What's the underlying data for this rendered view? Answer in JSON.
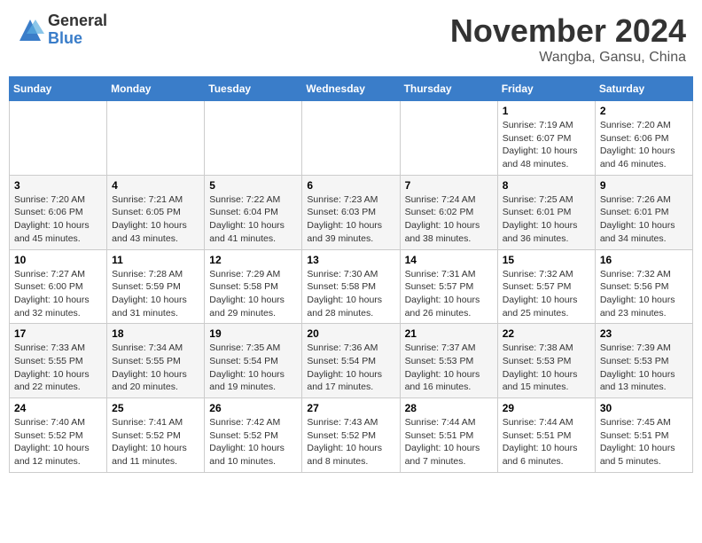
{
  "header": {
    "logo_general": "General",
    "logo_blue": "Blue",
    "month": "November 2024",
    "location": "Wangba, Gansu, China"
  },
  "weekdays": [
    "Sunday",
    "Monday",
    "Tuesday",
    "Wednesday",
    "Thursday",
    "Friday",
    "Saturday"
  ],
  "weeks": [
    [
      {
        "day": "",
        "info": ""
      },
      {
        "day": "",
        "info": ""
      },
      {
        "day": "",
        "info": ""
      },
      {
        "day": "",
        "info": ""
      },
      {
        "day": "",
        "info": ""
      },
      {
        "day": "1",
        "info": "Sunrise: 7:19 AM\nSunset: 6:07 PM\nDaylight: 10 hours\nand 48 minutes."
      },
      {
        "day": "2",
        "info": "Sunrise: 7:20 AM\nSunset: 6:06 PM\nDaylight: 10 hours\nand 46 minutes."
      }
    ],
    [
      {
        "day": "3",
        "info": "Sunrise: 7:20 AM\nSunset: 6:06 PM\nDaylight: 10 hours\nand 45 minutes."
      },
      {
        "day": "4",
        "info": "Sunrise: 7:21 AM\nSunset: 6:05 PM\nDaylight: 10 hours\nand 43 minutes."
      },
      {
        "day": "5",
        "info": "Sunrise: 7:22 AM\nSunset: 6:04 PM\nDaylight: 10 hours\nand 41 minutes."
      },
      {
        "day": "6",
        "info": "Sunrise: 7:23 AM\nSunset: 6:03 PM\nDaylight: 10 hours\nand 39 minutes."
      },
      {
        "day": "7",
        "info": "Sunrise: 7:24 AM\nSunset: 6:02 PM\nDaylight: 10 hours\nand 38 minutes."
      },
      {
        "day": "8",
        "info": "Sunrise: 7:25 AM\nSunset: 6:01 PM\nDaylight: 10 hours\nand 36 minutes."
      },
      {
        "day": "9",
        "info": "Sunrise: 7:26 AM\nSunset: 6:01 PM\nDaylight: 10 hours\nand 34 minutes."
      }
    ],
    [
      {
        "day": "10",
        "info": "Sunrise: 7:27 AM\nSunset: 6:00 PM\nDaylight: 10 hours\nand 32 minutes."
      },
      {
        "day": "11",
        "info": "Sunrise: 7:28 AM\nSunset: 5:59 PM\nDaylight: 10 hours\nand 31 minutes."
      },
      {
        "day": "12",
        "info": "Sunrise: 7:29 AM\nSunset: 5:58 PM\nDaylight: 10 hours\nand 29 minutes."
      },
      {
        "day": "13",
        "info": "Sunrise: 7:30 AM\nSunset: 5:58 PM\nDaylight: 10 hours\nand 28 minutes."
      },
      {
        "day": "14",
        "info": "Sunrise: 7:31 AM\nSunset: 5:57 PM\nDaylight: 10 hours\nand 26 minutes."
      },
      {
        "day": "15",
        "info": "Sunrise: 7:32 AM\nSunset: 5:57 PM\nDaylight: 10 hours\nand 25 minutes."
      },
      {
        "day": "16",
        "info": "Sunrise: 7:32 AM\nSunset: 5:56 PM\nDaylight: 10 hours\nand 23 minutes."
      }
    ],
    [
      {
        "day": "17",
        "info": "Sunrise: 7:33 AM\nSunset: 5:55 PM\nDaylight: 10 hours\nand 22 minutes."
      },
      {
        "day": "18",
        "info": "Sunrise: 7:34 AM\nSunset: 5:55 PM\nDaylight: 10 hours\nand 20 minutes."
      },
      {
        "day": "19",
        "info": "Sunrise: 7:35 AM\nSunset: 5:54 PM\nDaylight: 10 hours\nand 19 minutes."
      },
      {
        "day": "20",
        "info": "Sunrise: 7:36 AM\nSunset: 5:54 PM\nDaylight: 10 hours\nand 17 minutes."
      },
      {
        "day": "21",
        "info": "Sunrise: 7:37 AM\nSunset: 5:53 PM\nDaylight: 10 hours\nand 16 minutes."
      },
      {
        "day": "22",
        "info": "Sunrise: 7:38 AM\nSunset: 5:53 PM\nDaylight: 10 hours\nand 15 minutes."
      },
      {
        "day": "23",
        "info": "Sunrise: 7:39 AM\nSunset: 5:53 PM\nDaylight: 10 hours\nand 13 minutes."
      }
    ],
    [
      {
        "day": "24",
        "info": "Sunrise: 7:40 AM\nSunset: 5:52 PM\nDaylight: 10 hours\nand 12 minutes."
      },
      {
        "day": "25",
        "info": "Sunrise: 7:41 AM\nSunset: 5:52 PM\nDaylight: 10 hours\nand 11 minutes."
      },
      {
        "day": "26",
        "info": "Sunrise: 7:42 AM\nSunset: 5:52 PM\nDaylight: 10 hours\nand 10 minutes."
      },
      {
        "day": "27",
        "info": "Sunrise: 7:43 AM\nSunset: 5:52 PM\nDaylight: 10 hours\nand 8 minutes."
      },
      {
        "day": "28",
        "info": "Sunrise: 7:44 AM\nSunset: 5:51 PM\nDaylight: 10 hours\nand 7 minutes."
      },
      {
        "day": "29",
        "info": "Sunrise: 7:44 AM\nSunset: 5:51 PM\nDaylight: 10 hours\nand 6 minutes."
      },
      {
        "day": "30",
        "info": "Sunrise: 7:45 AM\nSunset: 5:51 PM\nDaylight: 10 hours\nand 5 minutes."
      }
    ]
  ]
}
